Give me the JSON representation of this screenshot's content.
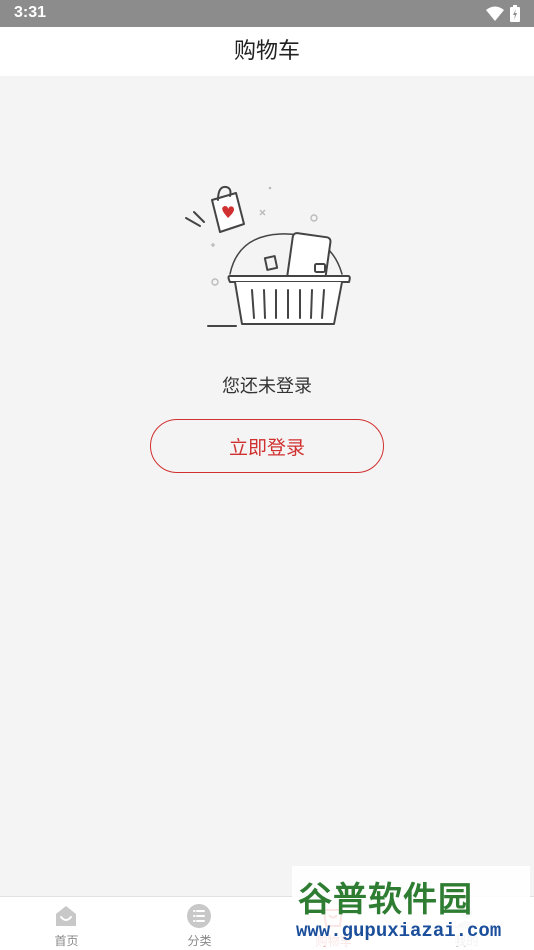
{
  "status_bar": {
    "time": "3:31",
    "icons": [
      "wifi-icon",
      "battery-icon"
    ]
  },
  "header": {
    "title": "购物车"
  },
  "empty_state": {
    "illustration": "shopping-basket-illustration",
    "message": "您还未登录",
    "login_button": "立即登录"
  },
  "tabbar": {
    "tabs": [
      {
        "label": "首页",
        "icon": "home-icon",
        "active": false
      },
      {
        "label": "分类",
        "icon": "category-icon",
        "active": false
      },
      {
        "label": "购物车",
        "icon": "cart-icon",
        "active": true
      },
      {
        "label": "我的",
        "icon": "profile-icon",
        "active": false
      }
    ]
  },
  "watermark": {
    "title": "谷普软件园",
    "url": "www.gupuxiazai.com"
  },
  "colors": {
    "accent": "#d0302f",
    "background": "#f4f4f4",
    "status_bar": "#8c8c8c"
  }
}
